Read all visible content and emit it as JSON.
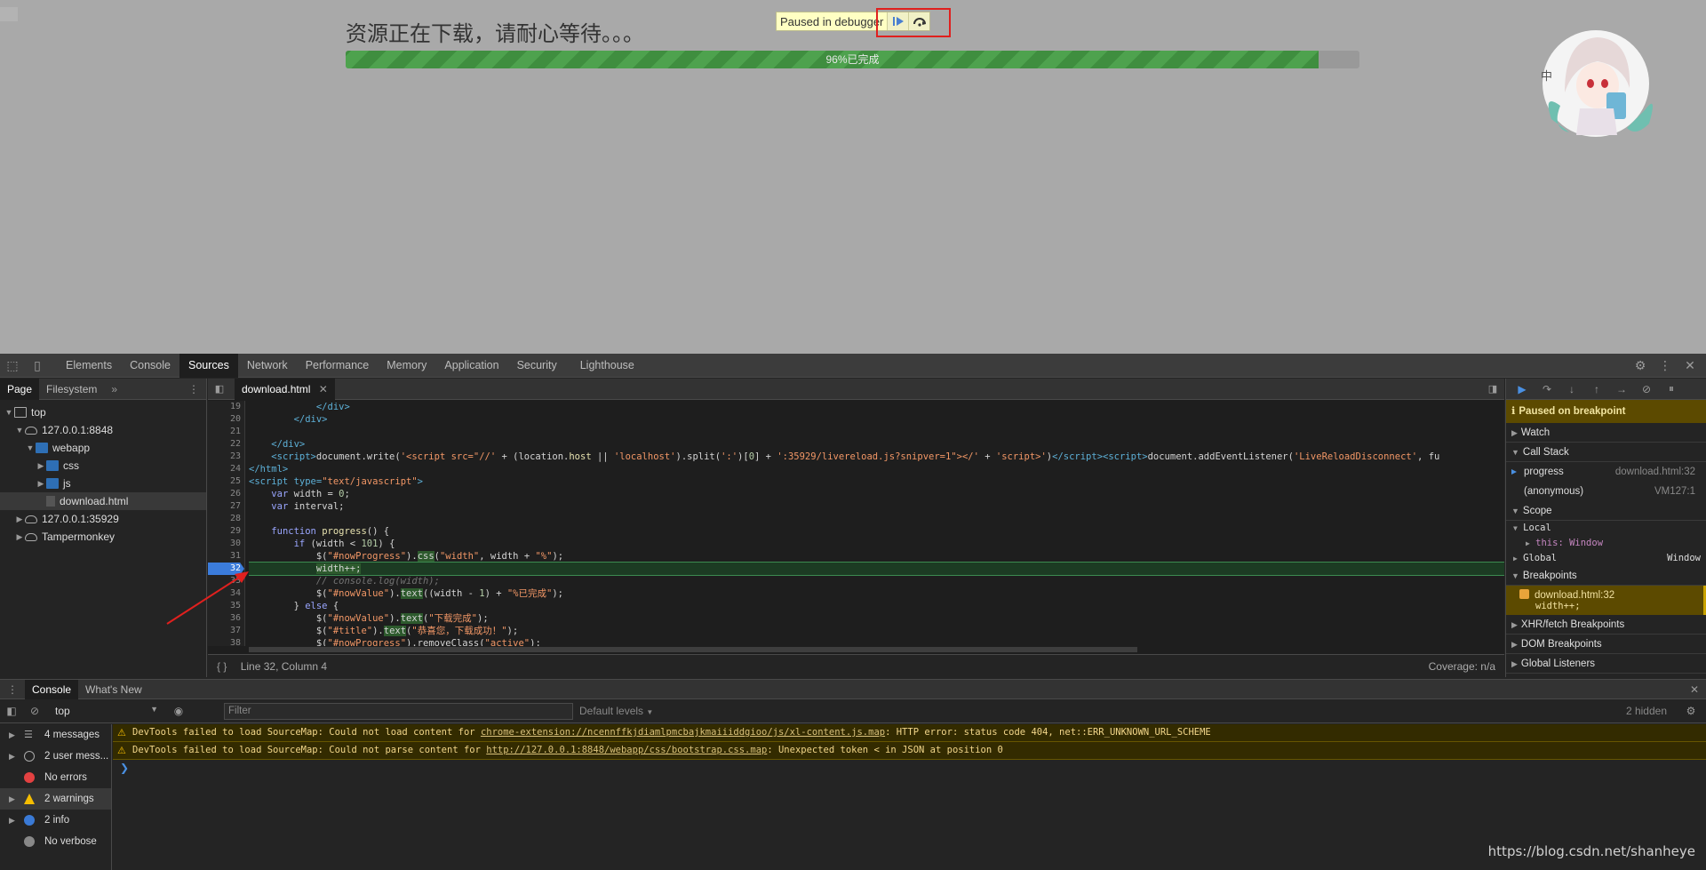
{
  "page": {
    "title": "资源正在下载，请耐心等待。。。",
    "progress_text": "96%已完成",
    "progress_fraction": 0.96,
    "paused_label": "Paused in debugger"
  },
  "devtools": {
    "tabs": [
      "Elements",
      "Console",
      "Sources",
      "Network",
      "Performance",
      "Memory",
      "Application",
      "Security",
      "Lighthouse"
    ],
    "active_tab": "Sources",
    "navigator": {
      "tabs": [
        "Page",
        "Filesystem"
      ],
      "tree": [
        {
          "label": "top",
          "depth": 0,
          "icon": "frame"
        },
        {
          "label": "127.0.0.1:8848",
          "depth": 1,
          "icon": "cloud"
        },
        {
          "label": "webapp",
          "depth": 2,
          "icon": "folder"
        },
        {
          "label": "css",
          "depth": 3,
          "icon": "folder"
        },
        {
          "label": "js",
          "depth": 3,
          "icon": "folder"
        },
        {
          "label": "download.html",
          "depth": 3,
          "icon": "file"
        },
        {
          "label": "127.0.0.1:35929",
          "depth": 1,
          "icon": "cloud"
        },
        {
          "label": "Tampermonkey",
          "depth": 1,
          "icon": "cloud"
        }
      ]
    },
    "editor": {
      "file_tab": "download.html",
      "status": "Line 32, Column 4",
      "coverage": "Coverage: n/a",
      "line_numbers": [
        "19",
        "20",
        "21",
        "22",
        "23",
        "24",
        "25",
        "26",
        "27",
        "28",
        "29",
        "30",
        "31",
        "32",
        "33",
        "34",
        "35",
        "36",
        "37",
        "38"
      ],
      "breakpoint_line": "32"
    },
    "debugger": {
      "paused_notice": "Paused on breakpoint",
      "watch": "Watch",
      "call_stack": "Call Stack",
      "frames": [
        {
          "name": "progress",
          "location": "download.html:32"
        },
        {
          "name": "(anonymous)",
          "location": "VM127:1"
        }
      ],
      "scope": "Scope",
      "local": "Local",
      "this_label": "this: Window",
      "global": "Global",
      "global_value": "Window",
      "breakpoints": "Breakpoints",
      "bp_file": "download.html:32",
      "bp_code": "width++;",
      "xhr": "XHR/fetch Breakpoints",
      "dom": "DOM Breakpoints",
      "global_listeners": "Global Listeners"
    },
    "drawer": {
      "tabs": [
        "Console",
        "What's New"
      ],
      "context": "top",
      "filter_placeholder": "Filter",
      "levels": "Default levels",
      "hidden": "2 hidden",
      "sidebar": [
        {
          "label": "4 messages",
          "icon": "list"
        },
        {
          "label": "2 user mess...",
          "icon": "user"
        },
        {
          "label": "No errors",
          "icon": "error"
        },
        {
          "label": "2 warnings",
          "icon": "warning"
        },
        {
          "label": "2 info",
          "icon": "info"
        },
        {
          "label": "No verbose",
          "icon": "verbose"
        }
      ],
      "warning1_pre": "DevTools failed to load SourceMap: Could not load content for ",
      "warning1_link": "chrome-extension://ncennffkjdiamlpmcbajkmaiiiddgioo/js/xl-content.js.map",
      "warning1_post": ": HTTP error: status code 404, net::ERR_UNKNOWN_URL_SCHEME",
      "warning2_pre": "DevTools failed to load SourceMap: Could not parse content for ",
      "warning2_link": "http://127.0.0.1:8848/webapp/css/bootstrap.css.map",
      "warning2_post": ": Unexpected token < in JSON at position 0"
    }
  },
  "watermark": "https://blog.csdn.net/shanheye",
  "colors": {
    "accent": "#4a90e2",
    "warning": "#f5bd00",
    "highlight": "#e0201e",
    "progress": "#4ea24e"
  }
}
